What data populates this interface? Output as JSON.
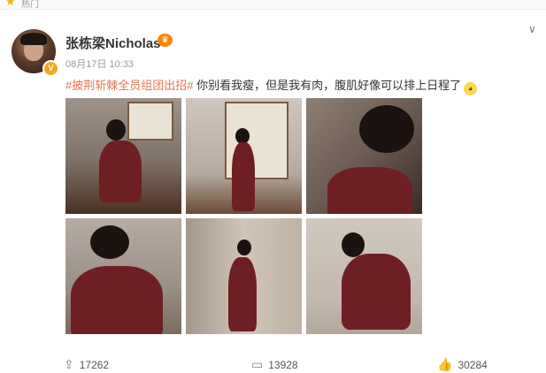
{
  "topbar": {
    "label": "热门"
  },
  "user": {
    "name": "张栋梁Nicholas",
    "badge": "V"
  },
  "post": {
    "date": "08月17日 10:33",
    "hashtag": "#披荆斩棘全员组团出招#",
    "text": " 你别看我瘦，但是我有肉，腹肌好像可以排上日程了"
  },
  "actions": {
    "reposts": "17262",
    "comments": "13928",
    "likes": "30284"
  },
  "icons": {
    "star": "star-icon",
    "vip": "vip-crown-icon",
    "more": "chevron-down-icon",
    "repost": "repost-icon",
    "comment": "comment-icon",
    "like": "thumbs-up-icon"
  },
  "colors": {
    "hashtag": "#eb7350",
    "vip": "#ff8200",
    "verified": "#f5a623"
  }
}
